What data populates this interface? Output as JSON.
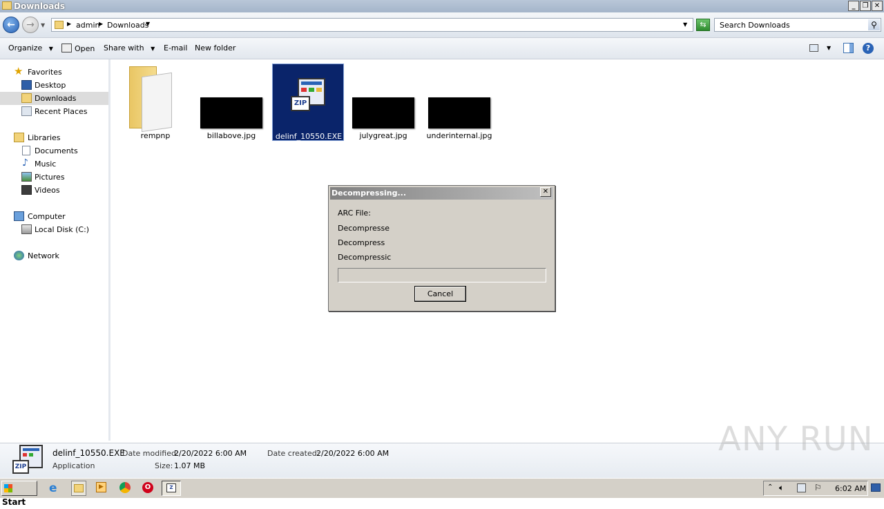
{
  "window": {
    "title": "Downloads"
  },
  "address": {
    "crumbs": [
      "admin",
      "Downloads"
    ],
    "search_placeholder": "Search Downloads"
  },
  "toolbar": {
    "organize": "Organize",
    "open": "Open",
    "share_with": "Share with",
    "email": "E-mail",
    "new_folder": "New folder"
  },
  "sidebar": {
    "favorites": "Favorites",
    "desktop": "Desktop",
    "downloads": "Downloads",
    "recent_places": "Recent Places",
    "libraries": "Libraries",
    "documents": "Documents",
    "music": "Music",
    "pictures": "Pictures",
    "videos": "Videos",
    "computer": "Computer",
    "local_disk": "Local Disk (C:)",
    "network": "Network"
  },
  "files": [
    {
      "name": "rempnp",
      "kind": "folder"
    },
    {
      "name": "billabove.jpg",
      "kind": "image"
    },
    {
      "name": "delinf_10550.EXE",
      "kind": "exe",
      "selected": true
    },
    {
      "name": "julygreat.jpg",
      "kind": "image"
    },
    {
      "name": "underinternal.jpg",
      "kind": "image"
    }
  ],
  "dialog": {
    "title": "Decompressing...",
    "arc_file": "ARC File:",
    "line1": "Decompresse",
    "line2": "Decompress",
    "line3": "Decompressic",
    "progress": 0,
    "cancel": "Cancel"
  },
  "details": {
    "name": "delinf_10550.EXE",
    "type": "Application",
    "date_modified_label": "Date modified:",
    "date_modified": "2/20/2022 6:00 AM",
    "date_created_label": "Date created:",
    "date_created": "2/20/2022 6:00 AM",
    "size_label": "Size:",
    "size": "1.07 MB"
  },
  "taskbar": {
    "start": "Start",
    "clock": "6:02 AM"
  },
  "watermark": "ANY RUN",
  "colors": {
    "selection": "#0a246a",
    "folder": "#f2d37a",
    "title_accent": "#2a63b6"
  }
}
